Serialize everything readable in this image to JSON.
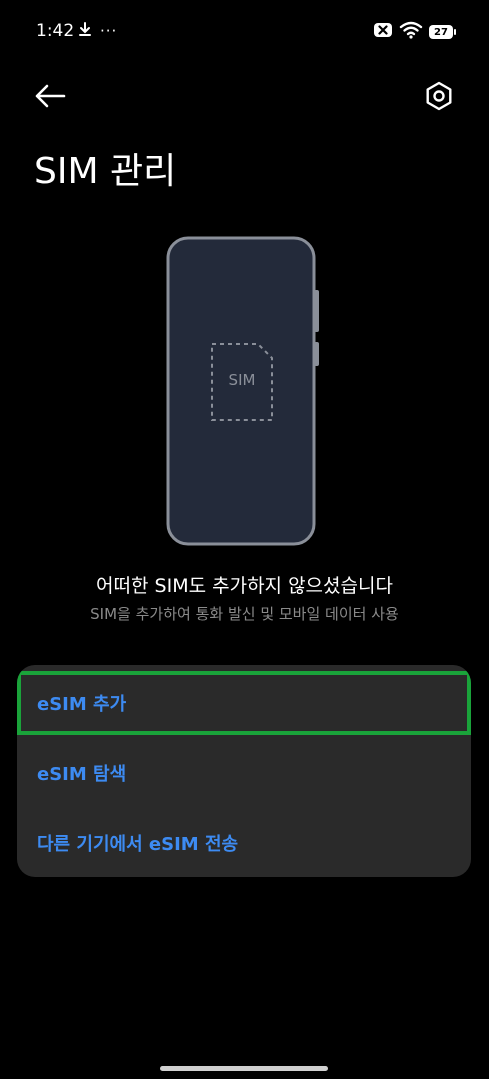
{
  "status_bar": {
    "time": "1:42",
    "more": "···",
    "battery": "27",
    "icons": [
      "download-icon",
      "close-badge-icon",
      "wifi-icon",
      "battery-icon"
    ]
  },
  "header": {
    "title": "SIM 관리",
    "icons": [
      "back-arrow-icon",
      "settings-hex-icon"
    ]
  },
  "illustration": {
    "sim_label": "SIM"
  },
  "empty_state": {
    "title": "어떠한 SIM도 추가하지 않으셨습니다",
    "subtitle": "SIM을 추가하여 통화 발신 및 모바일 데이터 사용"
  },
  "menu": {
    "items": [
      {
        "label": "eSIM 추가"
      },
      {
        "label": "eSIM 탐색"
      },
      {
        "label": "다른 기기에서 eSIM 전송"
      }
    ]
  },
  "colors": {
    "accent": "#3d8bf2",
    "card": "#2a2a2a",
    "highlight": "#1aa33a",
    "phone_body": "#232a3a"
  }
}
